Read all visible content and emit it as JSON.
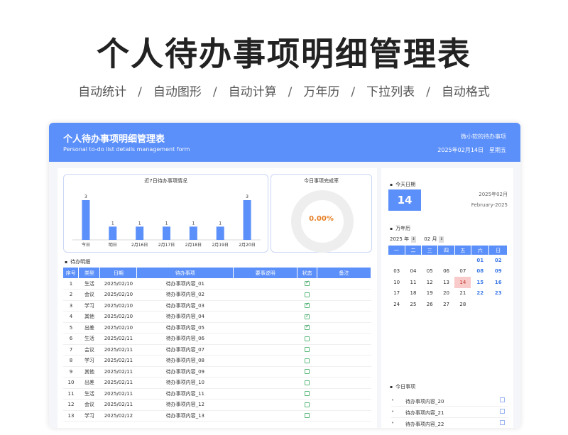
{
  "hero": {
    "title": "个人待办事项明细管理表",
    "features": [
      "自动统计",
      "自动图形",
      "自动计算",
      "万年历",
      "下拉列表",
      "自动格式"
    ],
    "separator": "/"
  },
  "header": {
    "title": "个人待办事项明细管理表",
    "subtitle": "Personal to-do list details management form",
    "owner": "微小软的待办事项",
    "date": "2025年02月14日",
    "weekday": "星期五"
  },
  "chart": {
    "title": "近7日待办事项情况"
  },
  "chart_data": {
    "type": "bar",
    "title": "近7日待办事项情况",
    "categories": [
      "今日",
      "明日",
      "2月16日",
      "2月17日",
      "2月18日",
      "2月19日",
      "2月20日"
    ],
    "values": [
      3,
      1,
      1,
      1,
      1,
      1,
      3
    ],
    "ylim": [
      0,
      3
    ],
    "grid": false,
    "colors": {
      "bar": "#5b8ff9"
    }
  },
  "rate": {
    "title": "今日事项完成率",
    "value": "0.00%"
  },
  "table": {
    "section_label": "待办明细",
    "headers": [
      "序号",
      "类型",
      "日期",
      "待办事项",
      "要事说明",
      "状态",
      "备注"
    ],
    "rows": [
      {
        "no": "1",
        "type": "生活",
        "date": "2025/02/10",
        "item": "待办事项内容_01",
        "note": "",
        "done": true,
        "remark": ""
      },
      {
        "no": "2",
        "type": "会议",
        "date": "2025/02/10",
        "item": "待办事项内容_02",
        "note": "",
        "done": false,
        "remark": ""
      },
      {
        "no": "3",
        "type": "学习",
        "date": "2025/02/10",
        "item": "待办事项内容_03",
        "note": "",
        "done": true,
        "remark": ""
      },
      {
        "no": "4",
        "type": "其他",
        "date": "2025/02/10",
        "item": "待办事项内容_04",
        "note": "",
        "done": true,
        "remark": ""
      },
      {
        "no": "5",
        "type": "出差",
        "date": "2025/02/10",
        "item": "待办事项内容_05",
        "note": "",
        "done": true,
        "remark": ""
      },
      {
        "no": "6",
        "type": "生活",
        "date": "2025/02/11",
        "item": "待办事项内容_06",
        "note": "",
        "done": false,
        "remark": ""
      },
      {
        "no": "7",
        "type": "会议",
        "date": "2025/02/11",
        "item": "待办事项内容_07",
        "note": "",
        "done": false,
        "remark": ""
      },
      {
        "no": "8",
        "type": "学习",
        "date": "2025/02/11",
        "item": "待办事项内容_08",
        "note": "",
        "done": false,
        "remark": ""
      },
      {
        "no": "9",
        "type": "其他",
        "date": "2025/02/11",
        "item": "待办事项内容_09",
        "note": "",
        "done": false,
        "remark": ""
      },
      {
        "no": "10",
        "type": "出差",
        "date": "2025/02/11",
        "item": "待办事项内容_10",
        "note": "",
        "done": false,
        "remark": ""
      },
      {
        "no": "11",
        "type": "生活",
        "date": "2025/02/11",
        "item": "待办事项内容_11",
        "note": "",
        "done": false,
        "remark": ""
      },
      {
        "no": "12",
        "type": "会议",
        "date": "2025/02/11",
        "item": "待办事项内容_12",
        "note": "",
        "done": false,
        "remark": ""
      },
      {
        "no": "13",
        "type": "学习",
        "date": "2025/02/12",
        "item": "待办事项内容_13",
        "note": "",
        "done": false,
        "remark": ""
      }
    ]
  },
  "today": {
    "section_label": "今天日期",
    "day": "14",
    "month_cn": "2025年02月",
    "month_en": "February-2025"
  },
  "calendar": {
    "section_label": "万年历",
    "year": "2025",
    "year_unit": "年",
    "month": "02",
    "month_unit": "月",
    "weekdays": [
      "一",
      "二",
      "三",
      "四",
      "五",
      "六",
      "日"
    ],
    "weeks": [
      [
        "",
        "",
        "",
        "",
        "",
        "01",
        "02"
      ],
      [
        "03",
        "04",
        "05",
        "06",
        "07",
        "08",
        "09"
      ],
      [
        "10",
        "11",
        "12",
        "13",
        "14",
        "15",
        "16"
      ],
      [
        "17",
        "18",
        "19",
        "20",
        "21",
        "22",
        "23"
      ],
      [
        "24",
        "25",
        "26",
        "27",
        "28",
        "",
        ""
      ]
    ],
    "today": "14"
  },
  "today_items": {
    "section_label": "今日事项",
    "items": [
      "待办事项内容_20",
      "待办事项内容_21",
      "待办事项内容_22"
    ]
  }
}
